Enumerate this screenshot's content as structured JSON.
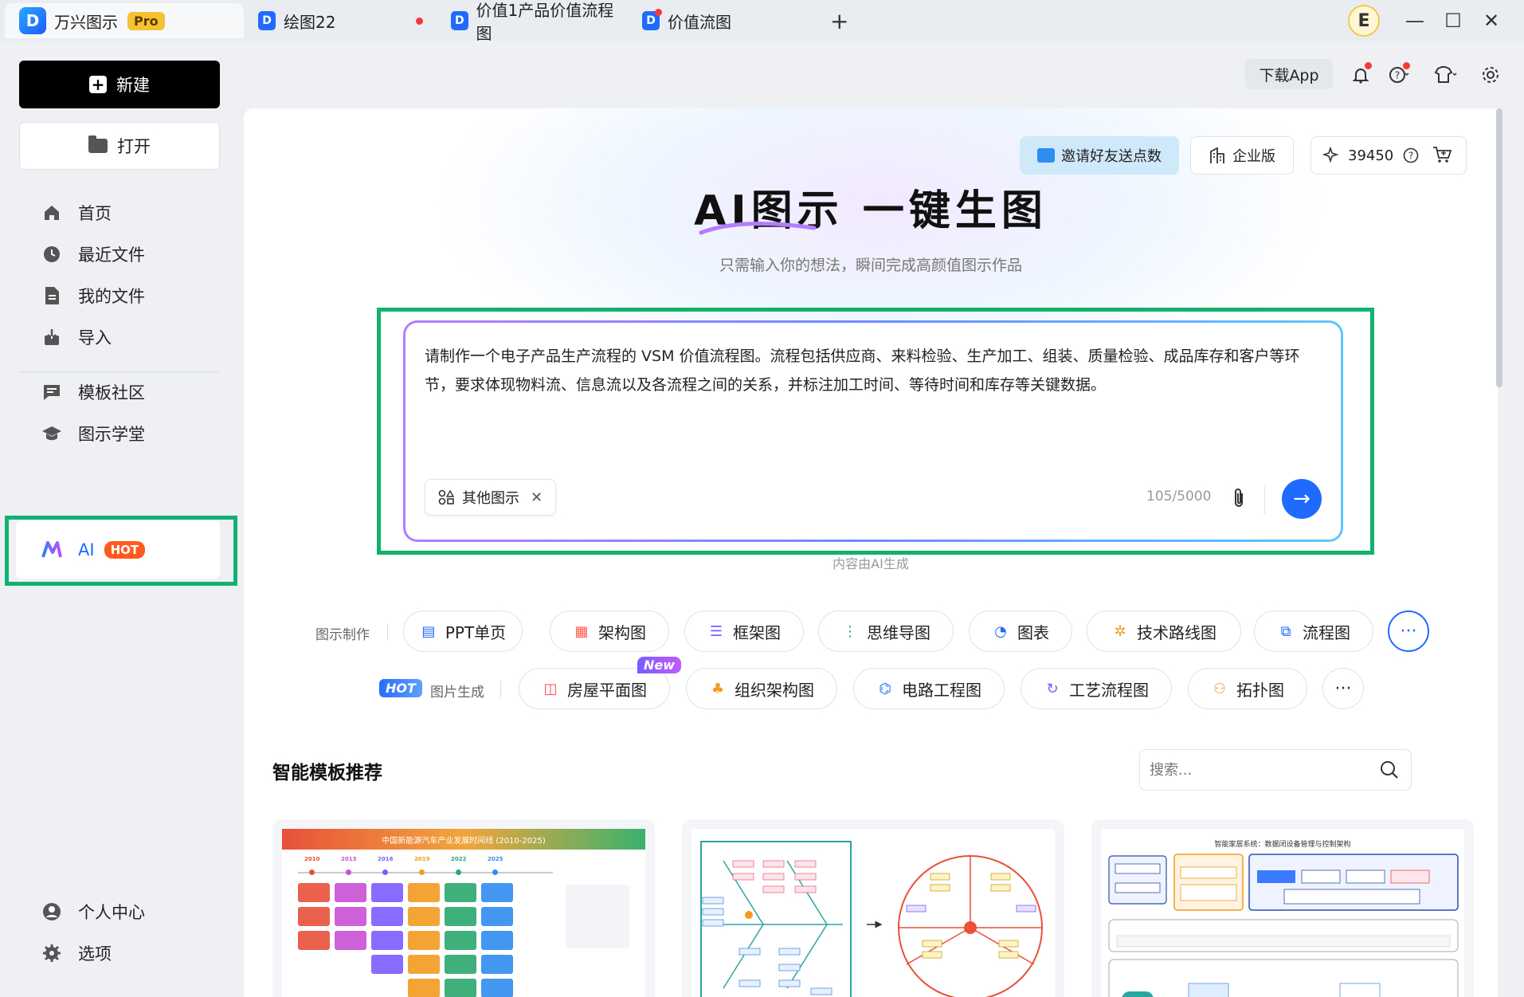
{
  "tabs": [
    {
      "label": "万兴图示",
      "badge": "Pro"
    },
    {
      "label": "绘图22"
    },
    {
      "label": "价值1产品价值流程图"
    },
    {
      "label": "价值流图"
    }
  ],
  "new_tab_symbol": "+",
  "user_initial": "E",
  "window_controls": {
    "minimize": "—",
    "maximize": "☐",
    "close": "✕"
  },
  "sidebar": {
    "new_label": "新建",
    "open_label": "打开",
    "nav": [
      "首页",
      "最近文件",
      "我的文件",
      "导入"
    ],
    "nav2": [
      "模板社区",
      "图示学堂"
    ],
    "ai_label": "AI",
    "ai_badge": "HOT",
    "bottom": [
      "个人中心",
      "选项"
    ]
  },
  "topbar": {
    "download_app": "下载App"
  },
  "promo": {
    "invite": "邀请好友送点数",
    "enterprise": "企业版",
    "points": "39450"
  },
  "hero": {
    "title": "AI图示 一键生图",
    "subtitle": "只需输入你的想法，瞬间完成高颜值图示作品"
  },
  "prompt": {
    "text": "请制作一个电子产品生产流程的 VSM 价值流程图。流程包括供应商、来料检验、生产加工、组装、质量检验、成品库存和客户等环节，要求体现物料流、信息流以及各流程之间的关系，并标注加工时间、等待时间和库存等关键数据。",
    "chip_label": "其他图示",
    "counter": "105/5000",
    "note": "内容由AI生成"
  },
  "tools_row1": {
    "label": "图示制作",
    "items": [
      "PPT单页",
      "架构图",
      "框架图",
      "思维导图",
      "图表",
      "技术路线图",
      "流程图"
    ],
    "more": "···"
  },
  "tools_row2": {
    "hot_tag": "HOT",
    "label": "图片生成",
    "new_tag": "New",
    "items": [
      "房屋平面图",
      "组织架构图",
      "电路工程图",
      "工艺流程图",
      "拓扑图"
    ],
    "more": "···"
  },
  "templates": {
    "title": "智能模板推荐",
    "search_placeholder": "搜索...",
    "card1_title": "中国新能源汽车产业发展时间线 (2010-2025)",
    "card1_years": [
      "2010",
      "2013",
      "2016",
      "2019",
      "2022",
      "2025"
    ],
    "card3_title": "智能家居系统：数据闭设备管理与控制架构"
  },
  "colors": {
    "accent_blue": "#1f6bff",
    "highlight_green": "#12b26e",
    "hot_orange": "#ff5a1f"
  }
}
